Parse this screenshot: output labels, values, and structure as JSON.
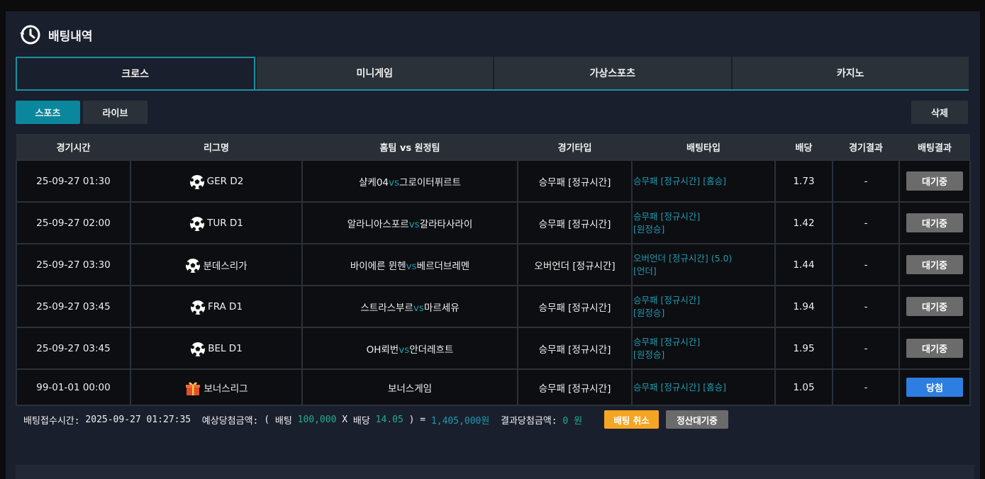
{
  "header": {
    "title": "배팅내역",
    "icon": "clock-history-icon"
  },
  "tabs": [
    {
      "label": "크로스",
      "active": true
    },
    {
      "label": "미니게임",
      "active": false
    },
    {
      "label": "가상스포츠",
      "active": false
    },
    {
      "label": "카지노",
      "active": false
    }
  ],
  "subtabs": [
    {
      "label": "스포츠",
      "active": true
    },
    {
      "label": "라이브",
      "active": false
    }
  ],
  "delete_label": "삭제",
  "table": {
    "columns": [
      "경기시간",
      "리그명",
      "홈팀 vs 원정팀",
      "경기타입",
      "배팅타입",
      "배당",
      "경기결과",
      "배팅결과"
    ],
    "rows": [
      {
        "time": "25-09-27 01:30",
        "league": "GER D2",
        "league_icon": "soccer-ball-icon",
        "home": "샬케04",
        "vs": "vs",
        "away": "그로이터퓌르트",
        "game_type": "승무패 [정규시간]",
        "bet_type_1": "승무패 [정규시간] [홈승]",
        "bet_type_2": "",
        "odds": "1.73",
        "game_result": "-",
        "bet_result": "대기중",
        "status": "pending"
      },
      {
        "time": "25-09-27 02:00",
        "league": "TUR D1",
        "league_icon": "soccer-ball-icon",
        "home": "알라니아스포르",
        "vs": "vs",
        "away": "갈라타사라이",
        "game_type": "승무패 [정규시간]",
        "bet_type_1": "승무패 [정규시간]",
        "bet_type_2": "[원정승]",
        "odds": "1.42",
        "game_result": "-",
        "bet_result": "대기중",
        "status": "pending"
      },
      {
        "time": "25-09-27 03:30",
        "league": "분데스리가",
        "league_icon": "soccer-ball-icon",
        "home": "바이에른 뮌헨",
        "vs": "vs",
        "away": "베르더브레멘",
        "game_type": "오버언더 [정규시간]",
        "bet_type_1": "오버언더 [정규시간] (5.0)",
        "bet_type_2": "[언더]",
        "odds": "1.44",
        "game_result": "-",
        "bet_result": "대기중",
        "status": "pending"
      },
      {
        "time": "25-09-27 03:45",
        "league": "FRA D1",
        "league_icon": "soccer-ball-icon",
        "home": "스트라스부르",
        "vs": "vs",
        "away": "마르세유",
        "game_type": "승무패 [정규시간]",
        "bet_type_1": "승무패 [정규시간]",
        "bet_type_2": "[원정승]",
        "odds": "1.94",
        "game_result": "-",
        "bet_result": "대기중",
        "status": "pending"
      },
      {
        "time": "25-09-27 03:45",
        "league": "BEL D1",
        "league_icon": "soccer-ball-icon",
        "home": "OH뢰번",
        "vs": "vs",
        "away": "안더레흐트",
        "game_type": "승무패 [정규시간]",
        "bet_type_1": "승무패 [정규시간]",
        "bet_type_2": "[원정승]",
        "odds": "1.95",
        "game_result": "-",
        "bet_result": "대기중",
        "status": "pending"
      },
      {
        "time": "99-01-01 00:00",
        "league": "보너스리그",
        "league_icon": "gift-box-icon",
        "home": "",
        "vs": "",
        "away": "",
        "match_text": "보너스게임",
        "game_type": "승무패 [정규시간]",
        "bet_type_1": "승무패 [정규시간] [홈승]",
        "bet_type_2": "",
        "odds": "1.05",
        "game_result": "-",
        "bet_result": "당첨",
        "status": "win"
      }
    ]
  },
  "summary": {
    "accept_label": "배팅접수시간:",
    "accept_time": "2025-09-27 01:27:35",
    "expected_label": "예상당첨금액:",
    "open": "(",
    "bet_label": "배팅",
    "bet_amount": "100,000",
    "times": "X",
    "odds_label": "배당",
    "odds_total": "14.05",
    "close_eq": ") =",
    "expected_amount": "1,405,000원",
    "result_label": "결과당첨금액:",
    "result_amount": "0 원",
    "cancel_label": "배팅 취소",
    "settle_label": "정산대기중"
  },
  "colors": {
    "accent": "#1a8fa3",
    "pending": "#6b6b6b",
    "win": "#2d7ee0",
    "cancel": "#f5a524",
    "link": "#1e9bb0"
  }
}
